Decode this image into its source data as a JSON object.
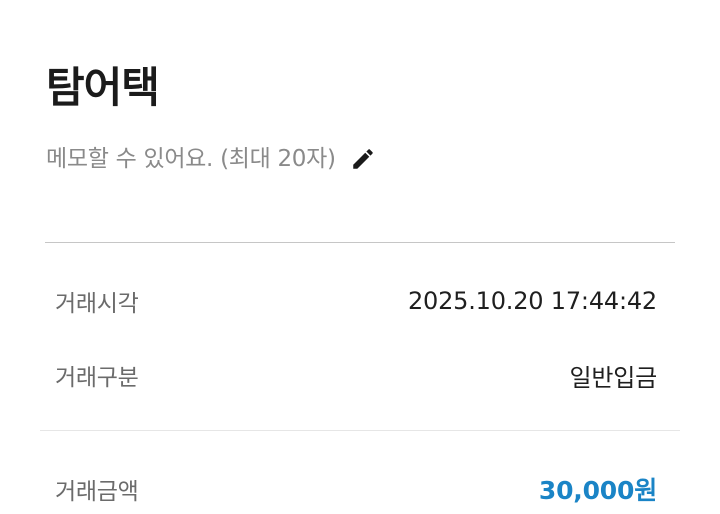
{
  "header": {
    "title": "탐어택"
  },
  "memo": {
    "placeholder": "메모할 수 있어요. (최대 20자)",
    "edit_icon": "pencil-icon"
  },
  "details": {
    "time": {
      "label": "거래시각",
      "value": "2025.10.20 17:44:42"
    },
    "type": {
      "label": "거래구분",
      "value": "일반입금"
    },
    "amount": {
      "label": "거래금액",
      "value": "30,000원",
      "color": "#1a84c6"
    }
  }
}
